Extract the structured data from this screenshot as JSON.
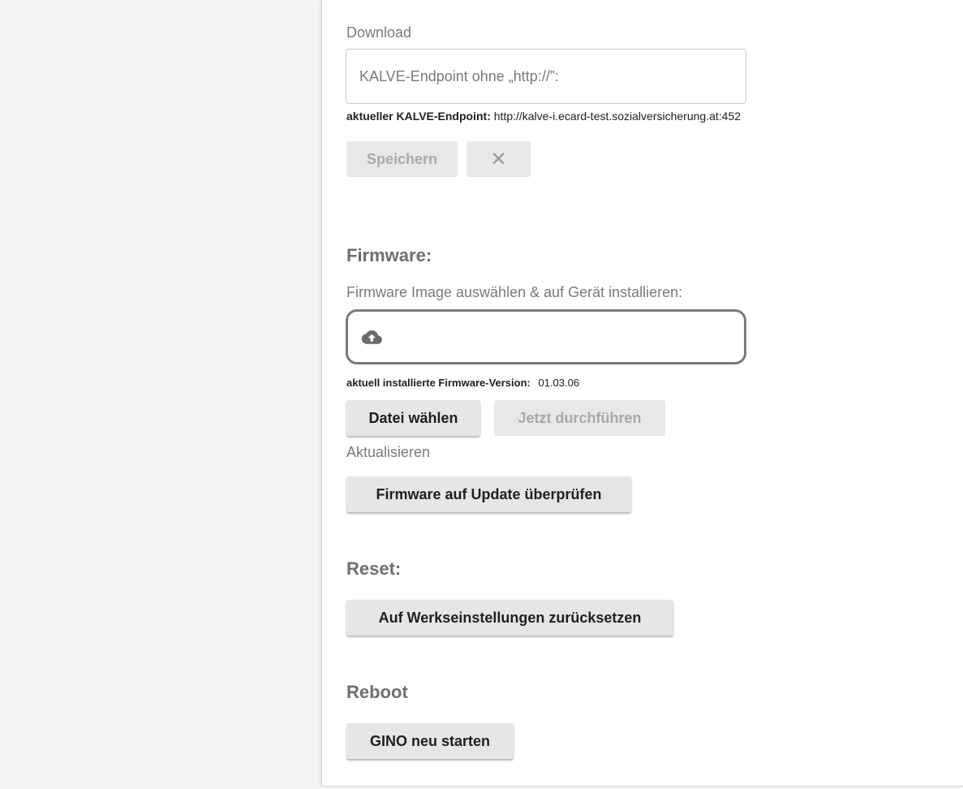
{
  "download": {
    "label": "Download",
    "endpoint_placeholder": "KALVE-Endpoint ohne „http://”:",
    "endpoint_value": "",
    "current_label": "aktueller KALVE-Endpoint:",
    "current_value": "http://kalve-i.ecard-test.sozialversicherung.at:452",
    "save_label": "Speichern",
    "cancel_icon": "close-icon"
  },
  "firmware": {
    "title": "Firmware:",
    "select_label": "Firmware Image auswählen & auf Gerät installieren:",
    "upload_icon": "cloud-upload-icon",
    "version_label": "aktuell installierte Firmware-Version:",
    "version_value": "01.03.06",
    "choose_file_label": "Datei wählen",
    "run_now_label": "Jetzt durchführen",
    "update_label": "Aktualisieren",
    "check_update_label": "Firmware auf Update überprüfen"
  },
  "reset": {
    "title": "Reset:",
    "factory_reset_label": "Auf Werkseinstellungen zurücksetzen"
  },
  "reboot": {
    "title": "Reboot",
    "restart_label": "GINO neu starten"
  },
  "colors": {
    "button_bg": "#e6e6e6",
    "disabled_text": "#a9a9a9",
    "section_title": "#6f6f6f",
    "left_background": "#f4f4f4"
  }
}
